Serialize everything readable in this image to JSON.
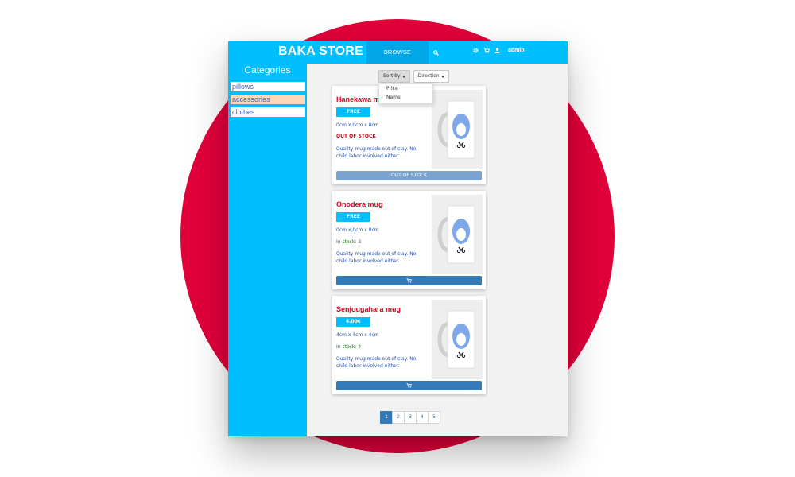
{
  "header": {
    "brand": "BAKA STORE",
    "browse_label": "BROWSE PRODUCTS",
    "user": "admin"
  },
  "sidebar": {
    "title": "Categories",
    "items": [
      {
        "label": "pillows",
        "active": false
      },
      {
        "label": "accessories",
        "active": true
      },
      {
        "label": "clothes",
        "active": false
      }
    ]
  },
  "sort": {
    "sort_by_label": "Sort by",
    "direction_label": "Direction",
    "options": [
      "Price",
      "Name"
    ]
  },
  "products": [
    {
      "name": "Hanekawa mug",
      "price": "FREE",
      "dimensions": "0cm x 0cm x 0cm",
      "stock": "OUT OF STOCK",
      "description": "Quality mug made out of clay. No child labor involved either.",
      "button_label": "OUT OF STOCK"
    },
    {
      "name": "Onodera mug",
      "price": "FREE",
      "dimensions": "0cm x 0cm x 0cm",
      "stock": "In stock: 3",
      "description": "Quality mug made out of clay. No child labor involved either."
    },
    {
      "name": "Senjougahara mug",
      "price": "4.00€",
      "dimensions": "4cm x 4cm x 4cm",
      "stock": "In stock: 4",
      "description": "Quality mug made out of clay. No child labor involved either."
    }
  ],
  "pagination": {
    "pages": [
      "1",
      "2",
      "3",
      "4",
      "5"
    ],
    "current": "1"
  },
  "icons": {
    "search": "search-icon",
    "settings": "gear-icon",
    "cart": "cart-icon",
    "user": "user-icon"
  },
  "colors": {
    "accent": "#00bfff",
    "brand_red": "#e1003a",
    "button_blue": "#337ab7",
    "title_red": "#e00024"
  }
}
